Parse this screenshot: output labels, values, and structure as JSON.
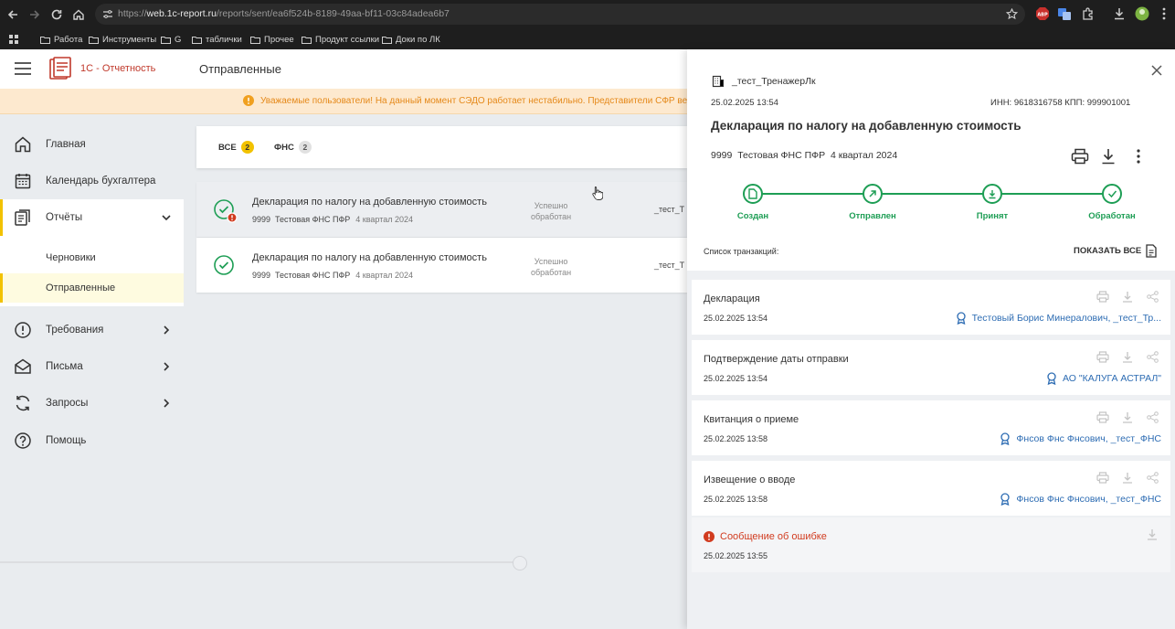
{
  "browser": {
    "url_host": "web.1c-report.ru",
    "url_path": "/reports/sent/ea6f524b-8189-49aa-bf11-03c84adea6b7",
    "url_scheme": "https://",
    "bookmarks": [
      "Работа",
      "Инструменты",
      "G",
      "таблички",
      "Прочее",
      "Продукт ссылки",
      "Доки по ЛК"
    ]
  },
  "app": {
    "logo_text": "1С - Отчетность",
    "page_title": "Отправленные",
    "notice": "Уважаемые пользователи! На данный момент СЭДО работает нестабильно. Представители СФР ведут р"
  },
  "sidebar": {
    "home": "Главная",
    "calendar": "Календарь бухгалтера",
    "reports": "Отчёты",
    "drafts": "Черновики",
    "sent": "Отправленные",
    "requirements": "Требования",
    "letters": "Письма",
    "requests": "Запросы",
    "help": "Помощь"
  },
  "filters": {
    "all_label": "ВСЕ",
    "all_count": "2",
    "fns_label": "ФНС",
    "fns_count": "2"
  },
  "reports": [
    {
      "title": "Декларация по налогу на добавленную стоимость",
      "code": "9999",
      "org": "Тестовая ФНС ПФР",
      "period": "4 квартал 2024",
      "status_1": "Успешно",
      "status_2": "обработан",
      "sender": "_тест_Т"
    },
    {
      "title": "Декларация по налогу на добавленную стоимость",
      "code": "9999",
      "org": "Тестовая ФНС ПФР",
      "period": "4 квартал 2024",
      "status_1": "Успешно",
      "status_2": "обработан",
      "sender": "_тест_Т"
    }
  ],
  "panel": {
    "org_name": "_тест_ТренажерЛк",
    "date": "25.02.2025 13:54",
    "inn_kpp": "ИНН: 9618316758   КПП: 999901001",
    "title": "Декларация по налогу на добавленную стоимость",
    "subtitle_code": "9999",
    "subtitle_org": "Тестовая ФНС ПФР",
    "subtitle_period": "4 квартал 2024",
    "steps": [
      "Создан",
      "Отправлен",
      "Принят",
      "Обработан"
    ],
    "tx_list_label": "Список транзакций:",
    "show_all": "ПОКАЗАТЬ ВСЕ"
  },
  "transactions": [
    {
      "title": "Декларация",
      "date": "25.02.2025 13:54",
      "signer": "Тестовый Борис Минералович, _тест_Тр..."
    },
    {
      "title": "Подтверждение даты отправки",
      "date": "25.02.2025 13:54",
      "signer": "АО \"КАЛУГА АСТРАЛ\""
    },
    {
      "title": "Квитанция о приеме",
      "date": "25.02.2025 13:58",
      "signer": "Фнсов Фнс Фнсович, _тест_ФНС"
    },
    {
      "title": "Извещение о вводе",
      "date": "25.02.2025 13:58",
      "signer": "Фнсов Фнс Фнсович, _тест_ФНС"
    },
    {
      "title": "Сообщение об ошибке",
      "date": "25.02.2025 13:55"
    }
  ],
  "colors": {
    "accent_yellow": "#f2c200",
    "success_green": "#1e9e55",
    "error_red": "#d13b1f",
    "link_blue": "#2d6cb3",
    "brand_red": "#c0392b",
    "notice_orange": "#e5891a"
  }
}
